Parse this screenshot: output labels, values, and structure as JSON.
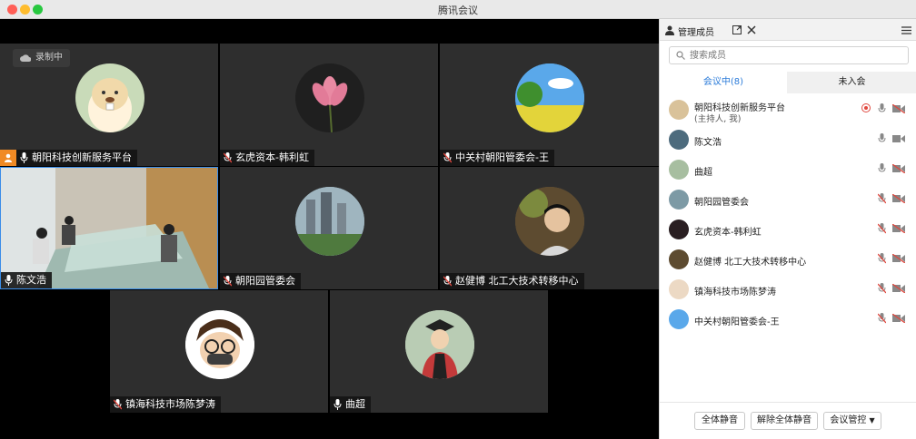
{
  "window": {
    "title": "腾讯会议"
  },
  "recording": {
    "label": "录制中"
  },
  "tiles": [
    {
      "name": "朝阳科技创新服务平台"
    },
    {
      "name": "玄虎资本-韩利虹"
    },
    {
      "name": "中关村朝阳管委会-王"
    },
    {
      "name": "陈文浩"
    },
    {
      "name": "朝阳园管委会"
    },
    {
      "name": "赵健博 北工大技术转移中心"
    },
    {
      "name": "镇海科技市场陈梦涛"
    },
    {
      "name": "曲超"
    }
  ],
  "panel": {
    "title": "管理成员",
    "search_placeholder": "搜索成员",
    "tab_in_meeting": "会议中(8)",
    "tab_not_joined": "未入会",
    "members": [
      {
        "name": "朝阳科技创新服务平台",
        "sub": "(主持人, 我)"
      },
      {
        "name": "陈文浩"
      },
      {
        "name": "曲超"
      },
      {
        "name": "朝阳园管委会"
      },
      {
        "name": "玄虎资本-韩利虹"
      },
      {
        "name": "赵健博 北工大技术转移中心"
      },
      {
        "name": "镇海科技市场陈梦涛"
      },
      {
        "name": "中关村朝阳管委会-王"
      }
    ],
    "buttons": {
      "mute_all": "全体静音",
      "unmute_all": "解除全体静音",
      "meeting_control": "会议管控"
    }
  },
  "colors": {
    "accent": "#2b7bd9",
    "muted_red": "#e0473e",
    "tile_bg": "#2e2e2e"
  }
}
